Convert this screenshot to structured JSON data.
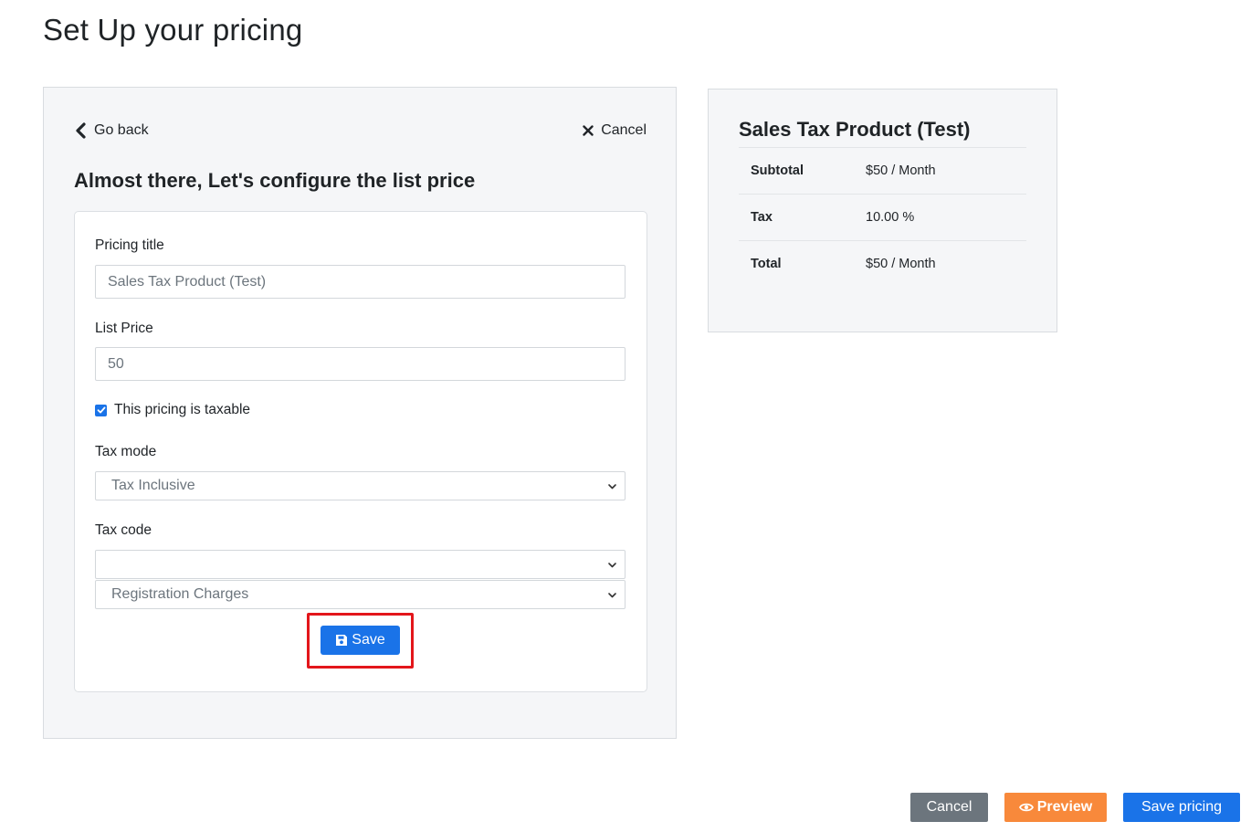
{
  "page": {
    "title": "Set Up your pricing"
  },
  "nav": {
    "go_back": "Go back",
    "cancel": "Cancel"
  },
  "config": {
    "heading": "Almost there, Let's configure the list price"
  },
  "form": {
    "pricing_title_label": "Pricing title",
    "pricing_title_value": "Sales Tax Product (Test)",
    "list_price_label": "List Price",
    "list_price_value": "50",
    "taxable_checked": true,
    "taxable_label": "This pricing is taxable",
    "tax_mode_label": "Tax mode",
    "tax_mode_value": "Tax Inclusive",
    "tax_code_label": "Tax code",
    "tax_code_value": "",
    "tax_code_sub_value": "Registration Charges",
    "save_label": "Save"
  },
  "summary": {
    "title": "Sales Tax Product (Test)",
    "rows": [
      {
        "label": "Subtotal",
        "value": "$50 / Month"
      },
      {
        "label": "Tax",
        "value": "10.00 %"
      },
      {
        "label": "Total",
        "value": "$50 / Month"
      }
    ]
  },
  "footer": {
    "cancel": "Cancel",
    "preview": "Preview",
    "save_pricing": "Save pricing"
  },
  "colors": {
    "primary": "#1a73e8",
    "secondary": "#6c757d",
    "warning": "#f8893b",
    "highlight": "#e3161b"
  },
  "icons": {
    "go_back": "chevron-left-icon",
    "cancel": "close-icon",
    "select": "chevron-down-icon",
    "save": "floppy-disk-icon",
    "preview": "eye-icon"
  }
}
